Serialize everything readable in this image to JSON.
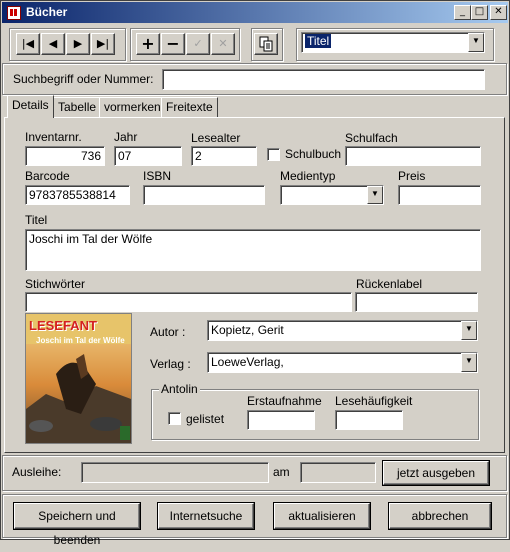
{
  "window": {
    "title": "Bücher"
  },
  "titlebar_buttons": {
    "minimize": "_",
    "maximize": "□",
    "close": "✕"
  },
  "nav": {
    "first": "|◀",
    "prev": "◀",
    "next": "▶",
    "last": "▶|",
    "add": "+",
    "remove": "−",
    "confirm": "✓",
    "cancel": "✕"
  },
  "sort_select": {
    "value": "Titel"
  },
  "search": {
    "label": "Suchbegriff oder Nummer:",
    "value": ""
  },
  "tabs": [
    {
      "label": "Details"
    },
    {
      "label": "Tabelle"
    },
    {
      "label": "vormerken"
    },
    {
      "label": "Freitexte"
    }
  ],
  "details": {
    "inventarnr": {
      "label": "Inventarnr.",
      "value": "736"
    },
    "jahr": {
      "label": "Jahr",
      "value": "07"
    },
    "lesealter": {
      "label": "Lesealter",
      "value": "2"
    },
    "schulbuch": {
      "label": "Schulbuch",
      "checked": false
    },
    "schulfach": {
      "label": "Schulfach",
      "value": ""
    },
    "barcode": {
      "label": "Barcode",
      "value": "9783785538814"
    },
    "isbn": {
      "label": "ISBN",
      "value": ""
    },
    "medientyp": {
      "label": "Medientyp",
      "value": ""
    },
    "preis": {
      "label": "Preis",
      "value": ""
    },
    "titel": {
      "label": "Titel",
      "value": "Joschi im Tal der Wölfe"
    },
    "stichwoerter": {
      "label": "Stichwörter",
      "value": ""
    },
    "rueckenlabel": {
      "label": "Rückenlabel",
      "value": ""
    },
    "autor": {
      "label": "Autor :",
      "value": "Kopietz, Gerit"
    },
    "verlag": {
      "label": "Verlag :",
      "value": "LoeweVerlag,"
    }
  },
  "cover": {
    "series": "LESEFANT",
    "title": "Joschi im Tal der Wölfe"
  },
  "antolin": {
    "label": "Antolin",
    "gelistet": {
      "label": "gelistet",
      "checked": false
    },
    "erstaufnahme": {
      "label": "Erstaufnahme",
      "value": ""
    },
    "lesehaeufigkeit": {
      "label": "Lesehäufigkeit",
      "value": ""
    }
  },
  "ausleihe": {
    "label": "Ausleihe:",
    "value": "",
    "am_label": "am",
    "am_value": "",
    "button": "jetzt ausgeben"
  },
  "footer": {
    "save": "Speichern und beenden",
    "internet": "Internetsuche",
    "refresh": "aktualisieren",
    "cancel": "abbrechen"
  },
  "colors": {
    "face": "#d4d0c8",
    "title_start": "#0a246a",
    "title_end": "#a6caf0"
  }
}
